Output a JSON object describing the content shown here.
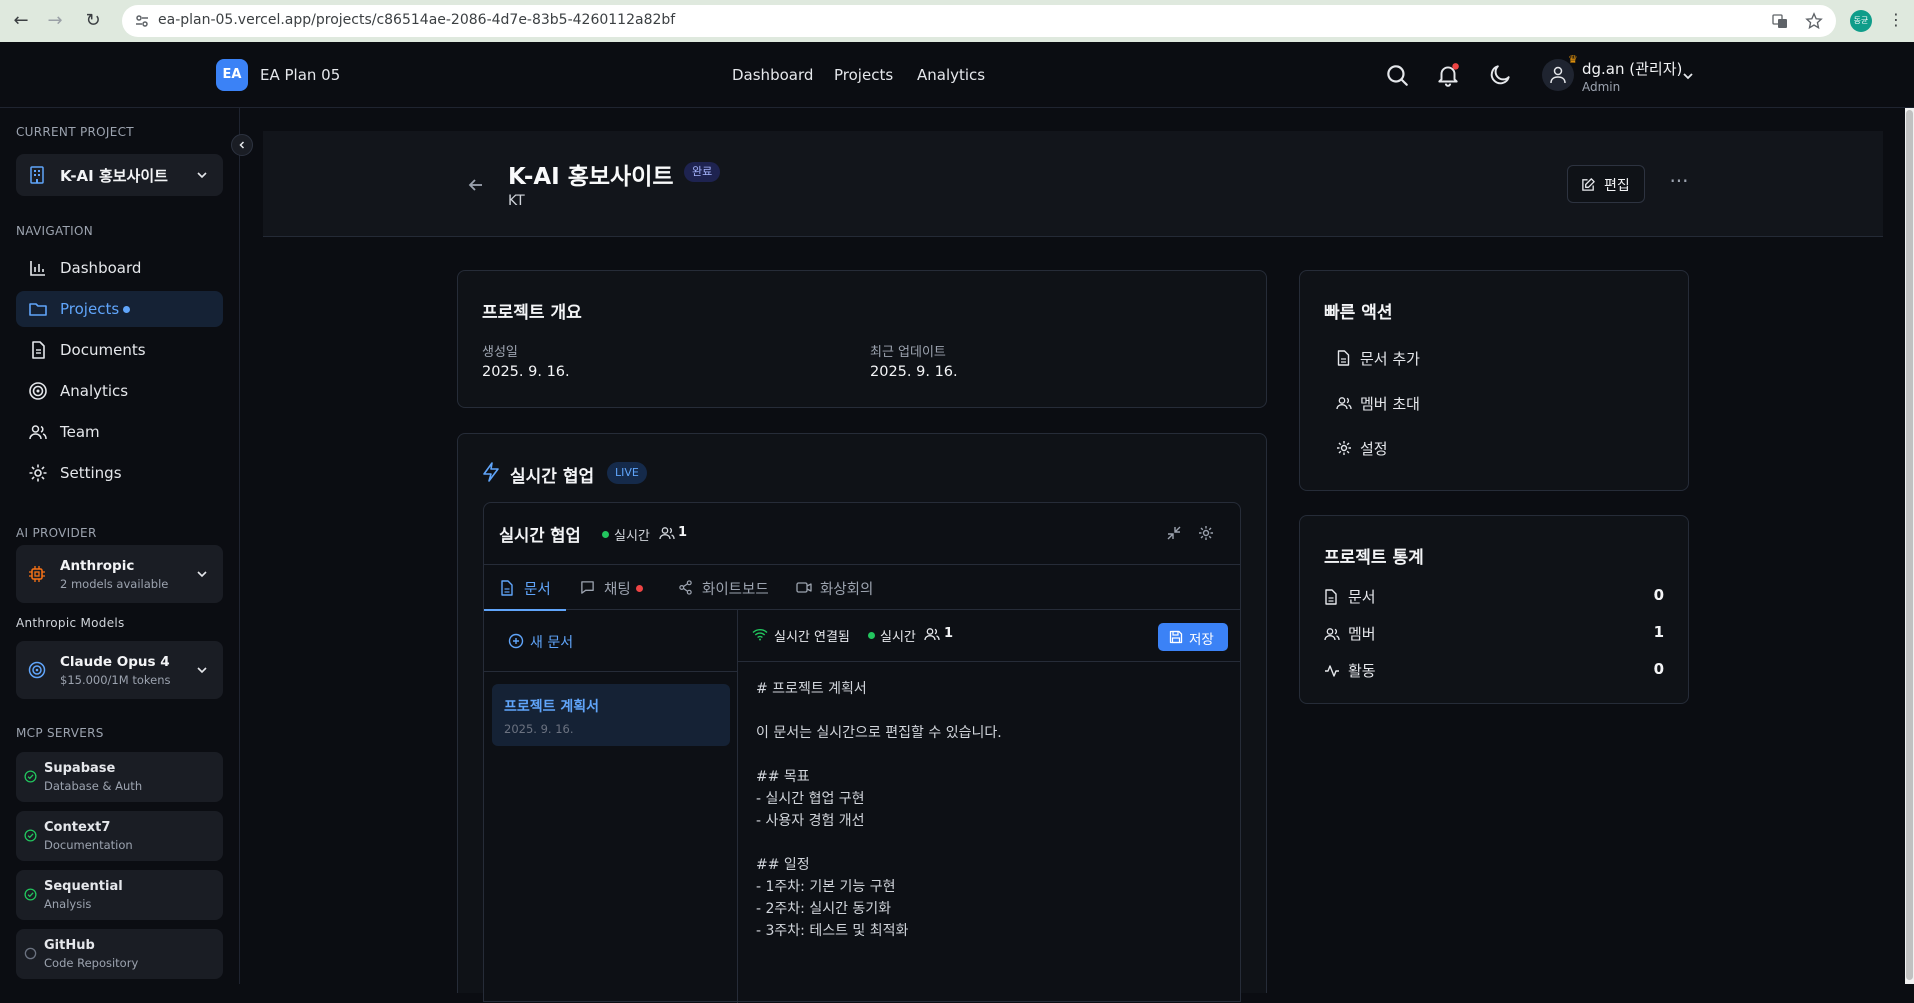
{
  "browser": {
    "url": "ea-plan-05.vercel.app/projects/c86514ae-2086-4d7e-83b5-4260112a82bf",
    "profile_initial": "동균"
  },
  "app": {
    "logo": "EA",
    "name": "EA Plan 05",
    "nav": [
      "Dashboard",
      "Projects",
      "Analytics"
    ],
    "user_name": "dg.an (관리자)",
    "user_role": "Admin"
  },
  "sidebar": {
    "current_project_heading": "CURRENT PROJECT",
    "current_project": "K-AI 홍보사이트",
    "navigation_heading": "NAVIGATION",
    "items": [
      {
        "label": "Dashboard",
        "icon": "bar-chart-icon"
      },
      {
        "label": "Projects",
        "icon": "folder-icon",
        "active": true
      },
      {
        "label": "Documents",
        "icon": "document-icon"
      },
      {
        "label": "Analytics",
        "icon": "target-icon"
      },
      {
        "label": "Team",
        "icon": "users-icon"
      },
      {
        "label": "Settings",
        "icon": "gear-icon"
      }
    ],
    "ai_provider_heading": "AI PROVIDER",
    "provider_name": "Anthropic",
    "provider_sub": "2 models available",
    "models_heading": "Anthropic Models",
    "model_name": "Claude Opus 4",
    "model_price": "$15.000/1M tokens",
    "mcp_heading": "MCP SERVERS",
    "mcp_servers": [
      {
        "name": "Supabase",
        "sub": "Database & Auth",
        "connected": true
      },
      {
        "name": "Context7",
        "sub": "Documentation",
        "connected": true
      },
      {
        "name": "Sequential",
        "sub": "Analysis",
        "connected": true
      },
      {
        "name": "GitHub",
        "sub": "Code Repository",
        "connected": false
      }
    ]
  },
  "project": {
    "title": "K-AI 홍보사이트",
    "status_badge": "완료",
    "org": "KT",
    "edit_label": "편집"
  },
  "overview": {
    "title": "프로젝트 개요",
    "created_label": "생성일",
    "created_value": "2025. 9. 16.",
    "updated_label": "최근 업데이트",
    "updated_value": "2025. 9. 16."
  },
  "collab": {
    "title": "실시간 협업",
    "live_badge": "LIVE",
    "inner_title": "실시간 협업",
    "realtime_label": "실시간",
    "user_count": "1",
    "tabs": [
      "문서",
      "채팅",
      "화이트보드",
      "화상회의"
    ],
    "new_doc_label": "새 문서",
    "doc_item_title": "프로젝트 계획서",
    "doc_item_date": "2025. 9. 16.",
    "connection_label": "실시간 연결됨",
    "save_label": "저장",
    "editor_lines": [
      "# 프로젝트 계획서",
      "",
      "이 문서는 실시간으로 편집할 수 있습니다.",
      "",
      "## 목표",
      "- 실시간 협업 구현",
      "- 사용자 경험 개선",
      "",
      "## 일정",
      "- 1주차: 기본 기능 구현",
      "- 2주차: 실시간 동기화",
      "- 3주차: 테스트 및 최적화"
    ]
  },
  "quick_actions": {
    "title": "빠른 액션",
    "items": [
      "문서 추가",
      "멤버 초대",
      "설정"
    ]
  },
  "stats": {
    "title": "프로젝트 통계",
    "rows": [
      {
        "label": "문서",
        "value": "0"
      },
      {
        "label": "멤버",
        "value": "1"
      },
      {
        "label": "활동",
        "value": "0"
      }
    ]
  },
  "colors": {
    "accent": "#3b82f6",
    "background": "#0b0d12",
    "success": "#22c55e",
    "danger": "#ef4444"
  }
}
